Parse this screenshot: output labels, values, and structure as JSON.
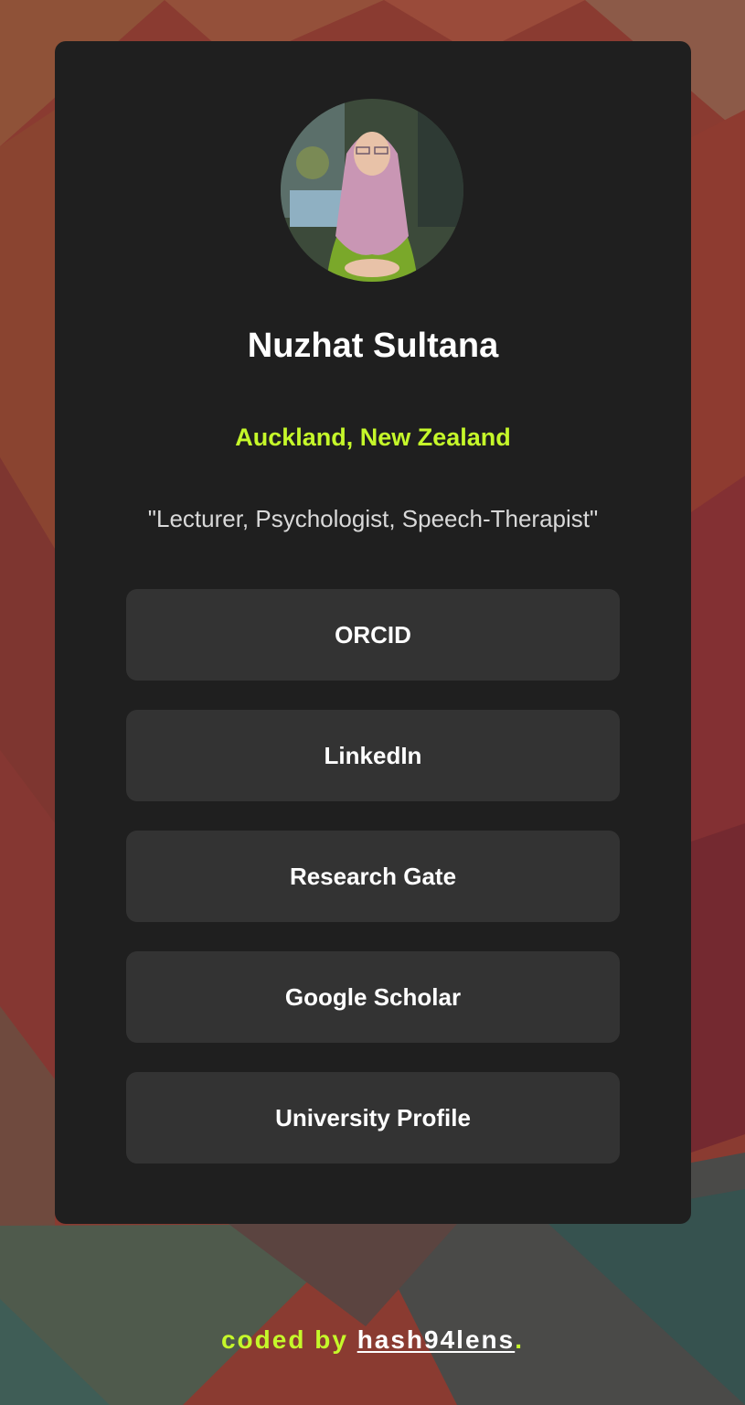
{
  "profile": {
    "name": "Nuzhat Sultana",
    "location": "Auckland, New Zealand",
    "bio": "\"Lecturer, Psychologist, Speech-Therapist\"",
    "avatar_icon": "profile-photo"
  },
  "links": [
    {
      "label": "ORCID"
    },
    {
      "label": "LinkedIn"
    },
    {
      "label": "Research Gate"
    },
    {
      "label": "Google Scholar"
    },
    {
      "label": "University Profile"
    }
  ],
  "footer": {
    "prefix": "coded by ",
    "author": "hash94lens",
    "suffix": "."
  },
  "colors": {
    "card": "#1f1f1f",
    "button": "#333333",
    "accent": "#c5f82a",
    "text": "#ffffff"
  }
}
